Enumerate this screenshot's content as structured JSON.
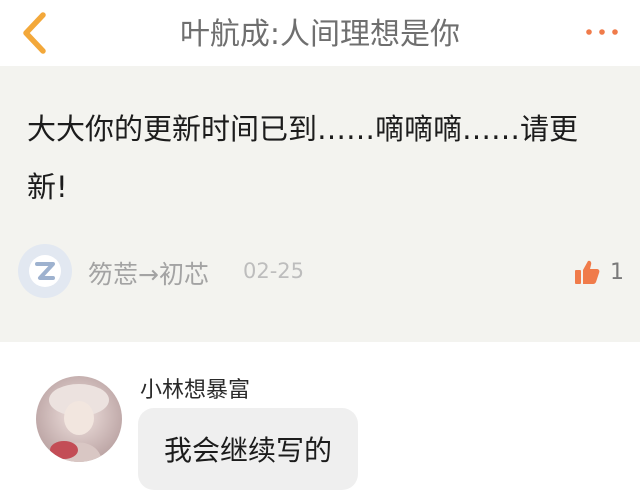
{
  "header": {
    "title": "叶航成:人间理想是你",
    "back_icon": "chevron-left-icon",
    "more_icon": "more-dots-icon",
    "accent_color": "#f3a83a"
  },
  "comment": {
    "text": "大大你的更新时间已到……嘀嘀嘀……请更新!",
    "author_name": "笏莣→初芯",
    "date": "02-25",
    "like_icon": "thumbs-up-icon",
    "like_count": "1",
    "like_color": "#f07b4a"
  },
  "reply": {
    "author_name": "小林想暴富",
    "text": "我会继续写的"
  }
}
